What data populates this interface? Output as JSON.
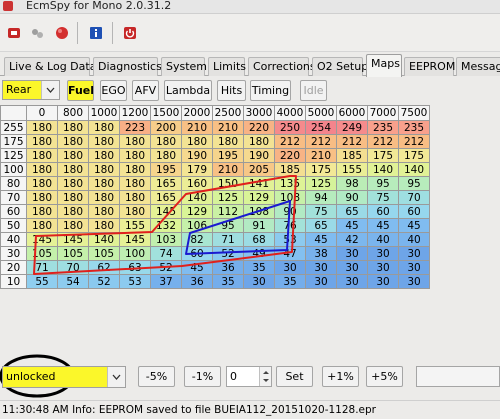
{
  "window": {
    "title": "EcmSpy for Mono 2.0.31.2"
  },
  "toolbar": {
    "buttons": [
      {
        "name": "connect-icon",
        "color": "#c62828"
      },
      {
        "name": "plugin-icon",
        "color": "#9e9e9e"
      },
      {
        "name": "record-icon",
        "color": "#d32f2f"
      },
      {
        "name": "info-icon",
        "color": "#1e50b4"
      },
      {
        "name": "power-icon",
        "color": "#c62828"
      }
    ]
  },
  "tabs": [
    {
      "label": "Live & Log Data",
      "active": false
    },
    {
      "label": "Diagnostics",
      "active": false
    },
    {
      "label": "System",
      "active": false
    },
    {
      "label": "Limits",
      "active": false
    },
    {
      "label": "Corrections",
      "active": false
    },
    {
      "label": "O2 Setup",
      "active": false
    },
    {
      "label": "Maps",
      "active": true
    },
    {
      "label": "EEPROM",
      "active": false
    },
    {
      "label": "Message",
      "active": false
    }
  ],
  "subbar": {
    "cylinder_select": "Rear",
    "buttons": [
      "Fuel",
      "EGO",
      "AFV",
      "Lambda",
      "Hits",
      "Timing",
      "Idle"
    ]
  },
  "map": {
    "rpm": [
      "0",
      "800",
      "1000",
      "1200",
      "1500",
      "2000",
      "2500",
      "3000",
      "4000",
      "5000",
      "6000",
      "7000",
      "7500"
    ],
    "rows": [
      {
        "load": "255",
        "values": [
          "180",
          "180",
          "180",
          "223",
          "200",
          "210",
          "210",
          "220",
          "250",
          "254",
          "249",
          "235",
          "235"
        ]
      },
      {
        "load": "175",
        "values": [
          "180",
          "180",
          "180",
          "180",
          "180",
          "180",
          "180",
          "180",
          "212",
          "212",
          "212",
          "212",
          "212"
        ]
      },
      {
        "load": "125",
        "values": [
          "180",
          "180",
          "180",
          "180",
          "180",
          "190",
          "195",
          "190",
          "220",
          "210",
          "185",
          "175",
          "175"
        ]
      },
      {
        "load": "100",
        "values": [
          "180",
          "180",
          "180",
          "180",
          "195",
          "179",
          "210",
          "205",
          "185",
          "175",
          "155",
          "140",
          "140"
        ]
      },
      {
        "load": "80",
        "values": [
          "180",
          "180",
          "180",
          "180",
          "165",
          "160",
          "150",
          "141",
          "135",
          "125",
          "98",
          "95",
          "95"
        ]
      },
      {
        "load": "70",
        "values": [
          "180",
          "180",
          "180",
          "180",
          "165",
          "140",
          "125",
          "129",
          "108",
          "94",
          "90",
          "75",
          "70"
        ]
      },
      {
        "load": "60",
        "values": [
          "180",
          "180",
          "180",
          "180",
          "145",
          "129",
          "112",
          "108",
          "90",
          "75",
          "65",
          "60",
          "60"
        ]
      },
      {
        "load": "50",
        "values": [
          "180",
          "180",
          "180",
          "155",
          "132",
          "106",
          "95",
          "91",
          "76",
          "65",
          "45",
          "45",
          "45"
        ]
      },
      {
        "load": "40",
        "values": [
          "145",
          "145",
          "140",
          "145",
          "103",
          "82",
          "71",
          "68",
          "53",
          "45",
          "42",
          "40",
          "40"
        ]
      },
      {
        "load": "30",
        "values": [
          "105",
          "105",
          "105",
          "100",
          "74",
          "60",
          "52",
          "49",
          "47",
          "38",
          "30",
          "30",
          "30"
        ]
      },
      {
        "load": "20",
        "values": [
          "71",
          "70",
          "62",
          "63",
          "52",
          "45",
          "36",
          "35",
          "30",
          "30",
          "30",
          "30",
          "30"
        ]
      },
      {
        "load": "10",
        "values": [
          "55",
          "54",
          "52",
          "53",
          "37",
          "36",
          "35",
          "30",
          "35",
          "30",
          "30",
          "30",
          "30"
        ]
      }
    ]
  },
  "bottom": {
    "lock_select": "unlocked",
    "minus5": "-5%",
    "minus1": "-1%",
    "set_value": "0",
    "set": "Set",
    "plus1": "+1%",
    "plus5": "+5%"
  },
  "status": {
    "text": "11:30:48 AM Info: EEPROM saved to file BUEIA112_20151020-1128.epr"
  },
  "annotations": {
    "highlight_color": "#fbf72a",
    "red": "#e0201c",
    "blue": "#1a1ad0",
    "ellipse": "#000000"
  }
}
